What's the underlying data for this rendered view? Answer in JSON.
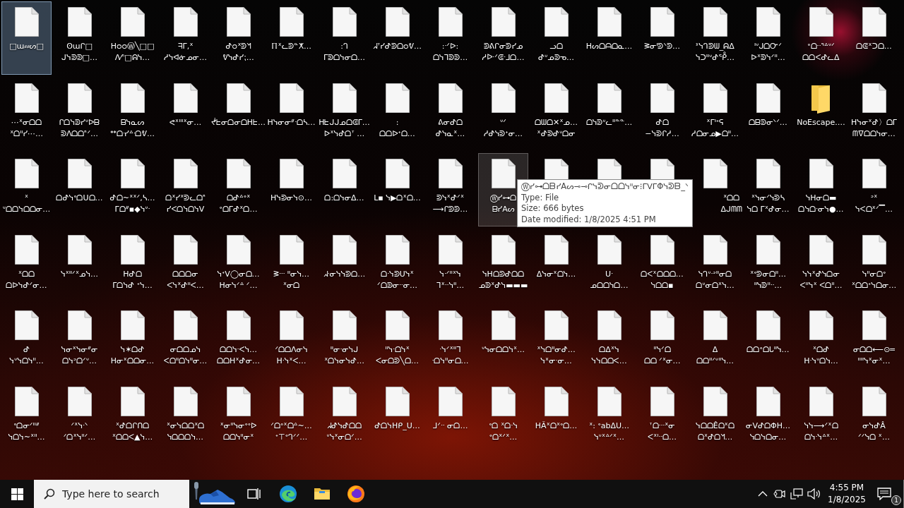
{
  "desktop": {
    "items": [
      {
        "kind": "file",
        "label": [
          "□ɯ⸗⸗ᔕ□"
        ],
        "selected": true,
        "hovered": false
      },
      {
        "kind": "file",
        "label": [
          "ʘɯᒋ□",
          "ᒍᓭᕲᕲ□…"
        ],
        "selected": false,
        "hovered": false
      },
      {
        "kind": "file",
        "label": [
          "ᕼᴑᴑⓌ╲□□",
          "ᐱ⁄ᐢ□ᕱᓭ…"
        ],
        "selected": false,
        "hovered": false
      },
      {
        "kind": "file",
        "label": [
          "ᖷᒥ,ᕽ",
          "ᓱᓭᐊᓃᓄᓂ…"
        ],
        "selected": false,
        "hovered": false
      },
      {
        "kind": "file",
        "label": [
          "ᕷᴑᕁᕲᖿ",
          "ᕓᓭᕷᓯ⁏…"
        ],
        "selected": false,
        "hovered": false
      },
      {
        "kind": "file",
        "label": [
          "ℿᕽᓚᕲᓐⵅ…"
        ],
        "selected": false,
        "hovered": false
      },
      {
        "kind": "file",
        "label": [
          ":ᒉ",
          "ᒥᕲᗝᓭᓂᗝ…"
        ],
        "selected": false,
        "hovered": false
      },
      {
        "kind": "file",
        "label": [
          "ᖽᐪᓯᕷᕲᗝᴑᕓ…"
        ],
        "selected": false,
        "hovered": false
      },
      {
        "kind": "file",
        "label": [
          ":ᐧᐟᐅ:",
          "ᗝᓭᒣᕲᕲ…"
        ],
        "selected": false,
        "hovered": false
      },
      {
        "kind": "file",
        "label": [
          "ᕲᕕᒋᓂᕲᓯᓄ",
          "ᓱᐓᐟᕳᐧᒧᗝ…"
        ],
        "selected": false,
        "hovered": false
      },
      {
        "kind": "file",
        "label": [
          "ᓗᗝ",
          "ᕷᐡᓄᕲᓀ…"
        ],
        "selected": false,
        "hovered": false
      },
      {
        "kind": "file",
        "label": [
          "ᕼᔕᗝᗩᗝᓇ…"
        ],
        "selected": false,
        "hovered": false
      },
      {
        "kind": "file",
        "label": [
          "ᕒᓂᑊᕲᐠᕲ…"
        ],
        "selected": false,
        "hovered": false
      },
      {
        "kind": "file",
        "label": [
          "ᕑᓭᒉᕲᗯ_ᕱᐃ",
          "ᓭᑐᐦᐡᕷᕾ…"
        ],
        "selected": false,
        "hovered": false
      },
      {
        "kind": "file",
        "label": [
          "ᑊᐡᒍᗝᏅᐟ",
          "ᐅᕽᕲᓭᐟᐦ…"
        ],
        "selected": false,
        "hovered": false
      },
      {
        "kind": "file",
        "label": [
          "ᐤᗝᐧᐧᕐᐞᐡᐟ",
          "ᗝᗝᐸᕷᓚᐃ"
        ],
        "selected": false,
        "hovered": false
      },
      {
        "kind": "file",
        "label": [
          "ᗝᕳᕽᑐᗝ…"
        ],
        "selected": false,
        "hovered": false
      },
      {
        "kind": "file",
        "label": [
          "⋯ᕽᓂᗝᗝ",
          "ᕽᗝᐦᓯ⋯…"
        ],
        "selected": false,
        "hovered": false
      },
      {
        "kind": "file",
        "label": [
          "ᒋᗝᓭᕲᓯᐡᐅᗷ",
          "ᕲᐱᗝᗝᑋᐟ…"
        ],
        "selected": false,
        "hovered": false
      },
      {
        "kind": "file",
        "label": [
          "ᗷᓭᓇᔕ",
          "ᕯᗝᓸᐞᐧᗝᕓ…"
        ],
        "selected": false,
        "hovered": false
      },
      {
        "kind": "file",
        "label": [
          "ᕙᕽᑊᐦᕽᓂ…"
        ],
        "selected": false,
        "hovered": false
      },
      {
        "kind": "file",
        "label": [
          "ᖫᖶᓂᗝᓂᗝᕼᖶ…"
        ],
        "selected": false,
        "hovered": false
      },
      {
        "kind": "file",
        "label": [
          "ᕼᓭᓂᓂᐥᐧᗝᓴ…"
        ],
        "selected": false,
        "hovered": false
      },
      {
        "kind": "file",
        "label": [
          "ᕼᖶᒍᒍᓄᗝᕳᒥ…",
          "ᐅᕽᓭᕷᗝᐪ …"
        ],
        "selected": false,
        "hovered": false
      },
      {
        "kind": "file",
        "label": [
          ":",
          "ᗝᗝᐅᐩᗝ…"
        ],
        "selected": false,
        "hovered": false
      },
      {
        "kind": "file",
        "label": [
          "ᕕᓂᕷᗝ",
          "ᕷᓭᓇᕽ…"
        ],
        "selected": false,
        "hovered": false
      },
      {
        "kind": "file",
        "label": [
          "ᐡᐟ",
          "ᓱᕷᓭᕲᐩᓂ…"
        ],
        "selected": false,
        "hovered": false
      },
      {
        "kind": "file",
        "label": [
          "ᗝᗯᗝ✕ᕽᓄ…",
          "ᕽᕷᕲᕷᐡᗝᓂ"
        ],
        "selected": false,
        "hovered": false
      },
      {
        "kind": "file",
        "label": [
          "ᗝᓭᕲᐡᓚᐦᓐᓐ…"
        ],
        "selected": false,
        "hovered": false
      },
      {
        "kind": "file",
        "label": [
          "ᕷᗝ",
          "−ᓭᕲᒋᓱ…"
        ],
        "selected": false,
        "hovered": false
      },
      {
        "kind": "file",
        "label": [
          "ᕽᒥᑊᐩᕋ",
          "ᓱᗝᓂᓄ▶ᗝᐦ…"
        ],
        "selected": false,
        "hovered": false
      },
      {
        "kind": "file",
        "label": [
          "ᗝᗷᕲᓂᐠᐟ…"
        ],
        "selected": false,
        "hovered": false
      },
      {
        "kind": "folder",
        "label": [
          "NoEscape.…"
        ],
        "selected": false,
        "hovered": false
      },
      {
        "kind": "file",
        "label": [
          "ᕼᓭᓂᕽᕷ〉ᗝᒥ",
          "ᗰᐁᗝᗝᓭᓂ…"
        ],
        "selected": false,
        "hovered": false
      },
      {
        "kind": "file",
        "label": [
          "ᕽ",
          "ᐡᗝᗝᓭᗝᗝᓂ…"
        ],
        "selected": false,
        "hovered": false
      },
      {
        "kind": "file",
        "label": [
          "ᗝᕷᓭᐤᗝᑌᗝ…"
        ],
        "selected": false,
        "hovered": false
      },
      {
        "kind": "file",
        "label": [
          "ᕷᗝ~ᕽᕽᐟ,ᓴ…",
          "ᒥᗝᐥ▪◆ᓭᐡᐧ"
        ],
        "selected": false,
        "hovered": false
      },
      {
        "kind": "file",
        "label": [
          "ᗝᕽᓯᕽᕲᓚᗝᑋ",
          "ᓯᐸᗝᓭᗝᓭᐯ"
        ],
        "selected": false,
        "hovered": false
      },
      {
        "kind": "file",
        "label": [
          "ᗝᕷᐞᐤᕽ",
          "ᐤᗝᒥᕷᕽᗝ…"
        ],
        "selected": false,
        "hovered": false
      },
      {
        "kind": "file",
        "label": [
          "ᕼᓭᕲᓂᓭ⊙…"
        ],
        "selected": false,
        "hovered": false
      },
      {
        "kind": "file",
        "label": [
          "ᗝ:ᗝᓭᓂᐃ…"
        ],
        "selected": false,
        "hovered": false
      },
      {
        "kind": "file",
        "label": [
          "ᒪ▪ ᓭ▶ᗝᕽᗝ…"
        ],
        "selected": false,
        "hovered": false
      },
      {
        "kind": "file",
        "label": [
          "ᕲᓭᕽᕷᐟᕽ",
          "⟶ᒋᕲᕲ…"
        ],
        "selected": false,
        "hovered": false
      },
      {
        "kind": "file",
        "label": [
          "Ⓦᓯ⊶ᗝ",
          "ᗷᓯAᔕ"
        ],
        "selected": false,
        "hovered": true
      },
      {
        "kind": "file",
        "selected": false,
        "hovered": false
      },
      {
        "kind": "file",
        "selected": false,
        "hovered": false
      },
      {
        "kind": "file",
        "selected": false,
        "hovered": false
      },
      {
        "kind": "file",
        "label": [
          "ᕽᗝᗝ",
          "ᐃᒍᗰᗰ"
        ],
        "partly_covered": true,
        "selected": false,
        "hovered": false
      },
      {
        "kind": "file",
        "label": [
          "ᕽᓭᓂᐟᓭᕲᓴ",
          "ᓭᗝ ᒥᕽᕷᓂ…"
        ],
        "selected": false,
        "hovered": false
      },
      {
        "kind": "file",
        "label": [
          "ᓭᕼᓂᗝ▬",
          "ᗝᓭᗝᐧᓂᓭ●…"
        ],
        "selected": false,
        "hovered": false
      },
      {
        "kind": "file",
        "label": [
          "ᐣᕽ",
          "ᓭᐸᗝᕽᐟ▔…"
        ],
        "selected": false,
        "hovered": false
      },
      {
        "kind": "file",
        "label": [
          "ᕽᗝᗝ",
          "ᗝᐅᓭᕷᐟᓂ…"
        ],
        "selected": false,
        "hovered": false
      },
      {
        "kind": "file",
        "label": [
          "ᓭᕽᐦᐟᕽᓄᓭ…"
        ],
        "selected": false,
        "hovered": false
      },
      {
        "kind": "file",
        "label": [
          "ᕼᕷᗝ",
          "ᒥᗝᓭᕷ ᐩᓭ…"
        ],
        "selected": false,
        "hovered": false
      },
      {
        "kind": "file",
        "label": [
          "ᗝᗝᗝᓂ",
          "ᐸᓭᕽᕷᐦᐸ…"
        ],
        "selected": false,
        "hovered": false
      },
      {
        "kind": "file",
        "label": [
          "ᓭᐩᐯ◯ᓂᗝ…",
          "ᕼᓂᓭᐟᐞ ᐟ…"
        ],
        "selected": false,
        "hovered": false
      },
      {
        "kind": "file",
        "label": [
          "ᕒᐧᐧᐧ ᐦᓂᓭ…",
          "ᕽᓂᗝ"
        ],
        "selected": false,
        "hovered": false
      },
      {
        "kind": "file",
        "label": [
          "ᖽᐧᓂᓭᓭᕲᗝ…"
        ],
        "selected": false,
        "hovered": false
      },
      {
        "kind": "file",
        "label": [
          "ᗝᐧᓭᕲᑌᓭᕽ",
          "ᐟᗝᕲᓂᐧᐧᓂ…"
        ],
        "selected": false,
        "hovered": false
      },
      {
        "kind": "file",
        "label": [
          "ᓭᐧᐟᐦᕽᓭ",
          "ᒣᕽᐧᐧᓭᐦ…"
        ],
        "selected": false,
        "hovered": false
      },
      {
        "kind": "file",
        "label": [
          "ᓭᕼᗝᕲᕷᗝᗝ",
          "ᓄᕲᕽᕷᓭ▬▬▬"
        ],
        "selected": false,
        "hovered": false
      },
      {
        "kind": "file",
        "label": [
          "ᐃᓭᓂᕽᗝᓭ…"
        ],
        "selected": false,
        "hovered": false
      },
      {
        "kind": "file",
        "label": [
          "ᑌᐧ",
          "ᓄᗝᗝᓭᗝ…"
        ],
        "selected": false,
        "hovered": false
      },
      {
        "kind": "file",
        "label": [
          "ᗝᐸᕽᗝᗝᗝ…",
          "ᓭᗝᗝ▪"
        ],
        "selected": false,
        "hovered": false
      },
      {
        "kind": "file",
        "label": [
          "ᓭᒉᐡᐧᐣᐦᓂᗝ",
          "ᗝᐡᓂᗝᕽᓭ…"
        ],
        "selected": false,
        "hovered": false
      },
      {
        "kind": "file",
        "label": [
          "ᕽᐤᕲᓂᗝᐦ…",
          "ᐦᓭᕲᐦᐧᐧ…"
        ],
        "selected": false,
        "hovered": false
      },
      {
        "kind": "file",
        "label": [
          "ᓭᓭᕽᕷᓭᗝᓂ",
          "ᐸᐦᓭᕽ ᐸᗝᐦ…"
        ],
        "selected": false,
        "hovered": false
      },
      {
        "kind": "file",
        "label": [
          "ᓭᐦᓂᗝᐤ",
          "ᕽᗝᗝᐩᓭᗝᓂ…"
        ],
        "selected": false,
        "hovered": false
      },
      {
        "kind": "file",
        "label": [
          "ᕷ",
          "ᓭᐡᓭᗝᓭᐦ…"
        ],
        "selected": false,
        "hovered": false
      },
      {
        "kind": "file",
        "label": [
          "ᓭᓂᕽᓭᓂᐥᓂ",
          "ᗝᓭᐣᗝᐟᐡ…"
        ],
        "selected": false,
        "hovered": false
      },
      {
        "kind": "file",
        "label": [
          "ᓭ✶ᗝᕷ",
          "ᕼᓂᕽᗝᗝᓂ…"
        ],
        "selected": false,
        "hovered": false
      },
      {
        "kind": "file",
        "label": [
          "ᓂᗝᗝᓄᓭ",
          "ᐸᗝᐦᗝᓭᐦᓂ…"
        ],
        "selected": false,
        "hovered": false
      },
      {
        "kind": "file",
        "label": [
          "ᗝᗝᓭᐧᐸᓭ…",
          "ᗝᗝᕼᕽᕷᓂ…"
        ],
        "selected": false,
        "hovered": false
      },
      {
        "kind": "file",
        "label": [
          "ᐟᗝᗝᐱᓂᓭ",
          "ᕼᐧᓭᕽᐸ…"
        ],
        "selected": false,
        "hovered": false
      },
      {
        "kind": "file",
        "label": [
          "ᐦᓂᐧᓂᓭᒍ",
          "ᕽᗝᓭᓂᓭᕷ…"
        ],
        "selected": false,
        "hovered": false
      },
      {
        "kind": "file",
        "label": [
          "ᐦᓭᐧᗝᓭᕽ",
          "ᐸᓂᗝᕲ╲ᗝ…"
        ],
        "selected": false,
        "hovered": false
      },
      {
        "kind": "file",
        "label": [
          "ᐧᓭᐟᕽᐦᒣ",
          "ᐧᗝᓭᐦᓂᗝ…"
        ],
        "selected": false,
        "hovered": false
      },
      {
        "kind": "file",
        "label": [
          "ᐡᓭᓂᗝᗝᓭᕽ…"
        ],
        "selected": false,
        "hovered": false
      },
      {
        "kind": "file",
        "label": [
          "ᕽᓭᗝᐦᓂᕷ…",
          "ᓭᕽᓂᐧᓂ…"
        ],
        "selected": false,
        "hovered": false
      },
      {
        "kind": "file",
        "label": [
          "ᗝᐃᕽᓭ",
          "ᓭᓭᗝᗝᐸ…"
        ],
        "selected": false,
        "hovered": false
      },
      {
        "kind": "file",
        "label": [
          "ᐦᓭᐟᗝ",
          "ᗝᗝ ᐟᕽᓂ…"
        ],
        "selected": false,
        "hovered": false
      },
      {
        "kind": "file",
        "label": [
          "ᐃ",
          "ᗝᗝᐦᐟᐡᐦᓭ…"
        ],
        "selected": false,
        "hovered": false
      },
      {
        "kind": "file",
        "label": [
          "ᗝᗝᐤᗝᒐᐦᓭ…"
        ],
        "selected": false,
        "hovered": false
      },
      {
        "kind": "file",
        "label": [
          "ᕽᗝᕷ",
          "ᕼᐧᓭᐡᗝᓭ…"
        ],
        "selected": false,
        "hovered": false
      },
      {
        "kind": "file",
        "label": [
          "ᓂᗝᗝ⟵⊙═",
          "ᐦᐦᓭᕽᓂᕽ…"
        ],
        "selected": false,
        "hovered": false
      },
      {
        "kind": "file",
        "label": [
          "ᐤᗝᓂᐟᐦᐥ",
          "ᓭᗝᓭ~ᕽᐦ…"
        ],
        "selected": false,
        "hovered": false
      },
      {
        "kind": "file",
        "label": [
          "ᐟᕽᓭᐧᐠ",
          "ᐟᗝᕽᓭᐦᐟ…"
        ],
        "selected": false,
        "hovered": false
      },
      {
        "kind": "file",
        "label": [
          "ᕽᕷᗝᒋᑎᗝ",
          "ᕽᗝᗝᐸ▲ᓭ…"
        ],
        "selected": false,
        "hovered": false
      },
      {
        "kind": "file",
        "label": [
          "ᕽᓂᓭᗝᗝᕽᗝ",
          "ᓭᗝᗝᗝᓭ…"
        ],
        "selected": false,
        "hovered": false
      },
      {
        "kind": "file",
        "label": [
          "ᕽᓂᐦᓭᓂᐤᐤᐅ",
          "ᗝᗝᓭᐦᓂᕽ"
        ],
        "selected": false,
        "hovered": false
      },
      {
        "kind": "file",
        "label": [
          "ᐟᗝᐤᕽᗝᐞ~…",
          "ᐩ⊤ᐤᒉᐟᐟ…"
        ],
        "selected": false,
        "hovered": false
      },
      {
        "kind": "file",
        "label": [
          "ᖽᕷᓭᕷᗝᗝ",
          "ᐡᓭᕽᓂᗝᐟ…"
        ],
        "selected": false,
        "hovered": false
      },
      {
        "kind": "file",
        "label": [
          "ᕷᗝᓭᕼᑭ_ᑌ…"
        ],
        "selected": false,
        "hovered": false
      },
      {
        "kind": "file",
        "label": [
          "ᒧᐟᐧᐧ ᓂᗝ…"
        ],
        "selected": false,
        "hovered": false
      },
      {
        "kind": "file",
        "label": [
          "ᐤᗝ ᕽᗝᐧᓭ",
          "ᐤᗝᕽᐟᕽ…"
        ],
        "selected": false,
        "hovered": false
      },
      {
        "kind": "file",
        "label": [
          "ᕼÃᕽᗝᕽᐤᗝ…"
        ],
        "selected": false,
        "hovered": false
      },
      {
        "kind": "file",
        "label": [
          "ᕽ: ᐤabᐃᑌ…",
          "ᓭᐡᕽᐞᐟᕽ…"
        ],
        "selected": false,
        "hovered": false
      },
      {
        "kind": "file",
        "label": [
          "ᐪᗝᐧᐧᐧᕽᓂ",
          "ᐸᕽᑊᐧᐧᗝ…"
        ],
        "selected": false,
        "hovered": false
      },
      {
        "kind": "file",
        "label": [
          "ᓭᗝᗝÊᗝᕽᗝ",
          "ᗝᕽᕷᗝᖿ…"
        ],
        "selected": false,
        "hovered": false
      },
      {
        "kind": "file",
        "label": [
          "ᓂᐯᕷᗝΦH…",
          "ᓭᗝᓭᗝᓂ…"
        ],
        "selected": false,
        "hovered": false
      },
      {
        "kind": "file",
        "label": [
          "ᓭᓭ⟶ᐟᕽᗝ",
          "ᗝᓭᐧᓭᐞᕽ…"
        ],
        "selected": false,
        "hovered": false
      },
      {
        "kind": "file",
        "label": [
          "ᓂᓭᕷÂ",
          "ᐟᐟᓭᗝ ᕽ…"
        ],
        "selected": false,
        "hovered": false
      }
    ]
  },
  "tooltip": {
    "lines": [
      "Ⓦᓯ⊶ᗝᗷᓯAᔕ⊸⊸ᒋᓭᕲᓂᗝᗝᓭᐦᓂ⁝ᒥᐯᒥΦᓭᕲᗷ_ᐠ",
      "Type: File",
      "Size: 666 bytes",
      "Date modified: 1/8/2025 4:51 PM"
    ]
  },
  "taskbar": {
    "search": {
      "placeholder": "Type here to search"
    },
    "clock": {
      "time": "4:55 PM",
      "date": "1/8/2025"
    },
    "notifications": {
      "badge": "1"
    }
  }
}
